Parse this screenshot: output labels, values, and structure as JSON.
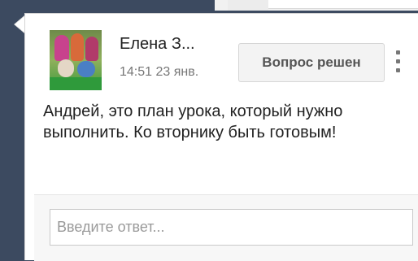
{
  "comment": {
    "author": "Елена З...",
    "timestamp": "14:51 23 янв.",
    "resolve_label": "Вопрос решен",
    "body": "Андрей, это план урока, который нужно выполнить. Ко вторнику быть готовым!",
    "reply_placeholder": "Введите ответ..."
  },
  "icons": {
    "menu": "more-vert-icon",
    "avatar": "user-photo"
  }
}
